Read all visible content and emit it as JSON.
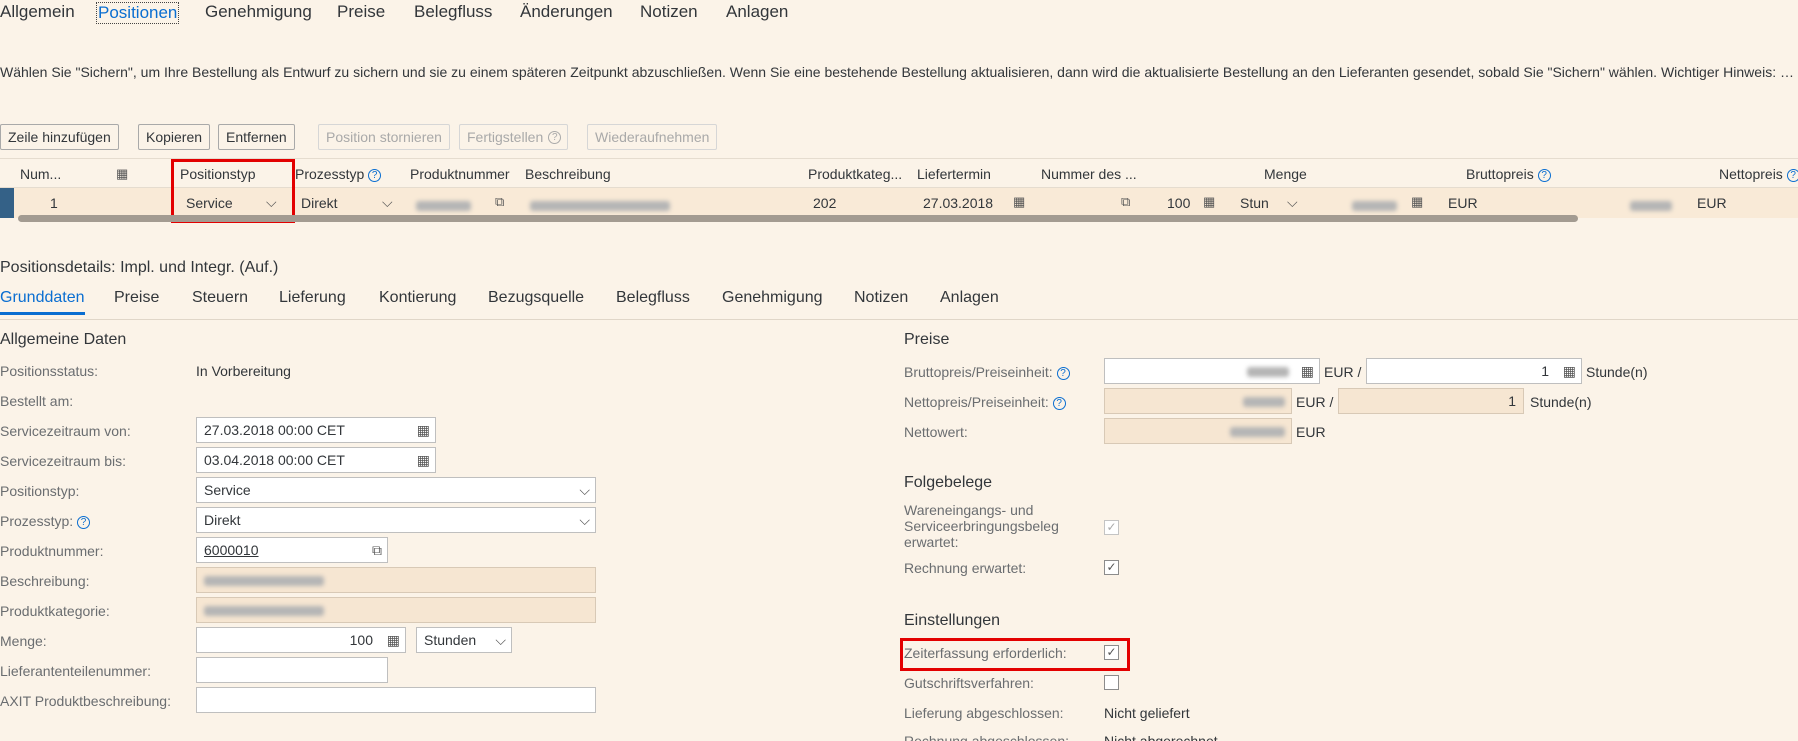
{
  "top_tabs": [
    "Allgemein",
    "Positionen",
    "Genehmigung",
    "Preise",
    "Belegfluss",
    "Änderungen",
    "Notizen",
    "Anlagen"
  ],
  "info_text": "Wählen Sie \"Sichern\", um Ihre Bestellung als Entwurf zu sichern und sie zu einem späteren Zeitpunkt abzuschließen. Wenn Sie eine bestehende Bestellung aktualisieren, dann wird die aktualisierte Bestellung an den Lieferanten gesendet, sobald Sie \"Sichern\" wählen. Wichtiger Hinweis: O...",
  "toolbar": {
    "add_row": "Zeile hinzufügen",
    "copy": "Kopieren",
    "remove": "Entfernen",
    "cancel_pos": "Position stornieren",
    "finish": "Fertigstellen",
    "resume": "Wiederaufnehmen"
  },
  "table": {
    "headers": {
      "num": "Num...",
      "positionstyp": "Positionstyp",
      "prozesstyp": "Prozesstyp",
      "produktnummer": "Produktnummer",
      "beschreibung": "Beschreibung",
      "produktkategorie": "Produktkateg...",
      "liefertermin": "Liefertermin",
      "nummer_des": "Nummer des ...",
      "menge": "Menge",
      "bruttopreis": "Bruttopreis",
      "nettopreis": "Nettopreis"
    },
    "row": {
      "num": "1",
      "positionstyp": "Service",
      "prozesstyp": "Direkt",
      "produktkategorie": "202",
      "liefertermin": "27.03.2018",
      "menge": "100",
      "einheit": "Stun",
      "brutto_currency": "EUR",
      "netto_currency": "EUR"
    }
  },
  "details": {
    "title": "Positionsdetails: Impl. und Integr. (Auf.)",
    "tabs": [
      "Grunddaten",
      "Preise",
      "Steuern",
      "Lieferung",
      "Kontierung",
      "Bezugsquelle",
      "Belegfluss",
      "Genehmigung",
      "Notizen",
      "Anlagen"
    ]
  },
  "general": {
    "title": "Allgemeine Daten",
    "status_label": "Positionsstatus:",
    "status_value": "In Vorbereitung",
    "ordered_label": "Bestellt am:",
    "from_label": "Servicezeitraum von:",
    "from_value": "27.03.2018 00:00 CET",
    "to_label": "Servicezeitraum bis:",
    "to_value": "03.04.2018 00:00 CET",
    "postype_label": "Positionstyp:",
    "postype_value": "Service",
    "proctype_label": "Prozesstyp:",
    "proctype_value": "Direkt",
    "prodnum_label": "Produktnummer:",
    "prodnum_value": "6000010",
    "desc_label": "Beschreibung:",
    "cat_label": "Produktkategorie:",
    "qty_label": "Menge:",
    "qty_value": "100",
    "qty_unit": "Stunden",
    "supplier_part_label": "Lieferantenteilenummer:",
    "axit_label": "AXIT Produktbeschreibung:"
  },
  "prices": {
    "title": "Preise",
    "gross_label": "Bruttopreis/Preiseinheit:",
    "gross_currency": "EUR /",
    "gross_unit_qty": "1",
    "gross_unit": "Stunde(n)",
    "net_label": "Nettopreis/Preiseinheit:",
    "net_currency": "EUR /",
    "net_unit_qty": "1",
    "net_unit": "Stunde(n)",
    "netvalue_label": "Nettowert:",
    "netvalue_currency": "EUR"
  },
  "followup": {
    "title": "Folgebelege",
    "gr_label": "Wareneingangs- und Serviceerbringungsbeleg erwartet:",
    "invoice_label": "Rechnung erwartet:"
  },
  "settings": {
    "title": "Einstellungen",
    "time_label": "Zeiterfassung erforderlich:",
    "credit_label": "Gutschriftsverfahren:",
    "delivery_label": "Lieferung abgeschlossen:",
    "delivery_value": "Nicht geliefert",
    "invoice_done_label": "Rechnung abgeschlossen:",
    "invoice_done_value": "Nicht abgerechnet"
  }
}
